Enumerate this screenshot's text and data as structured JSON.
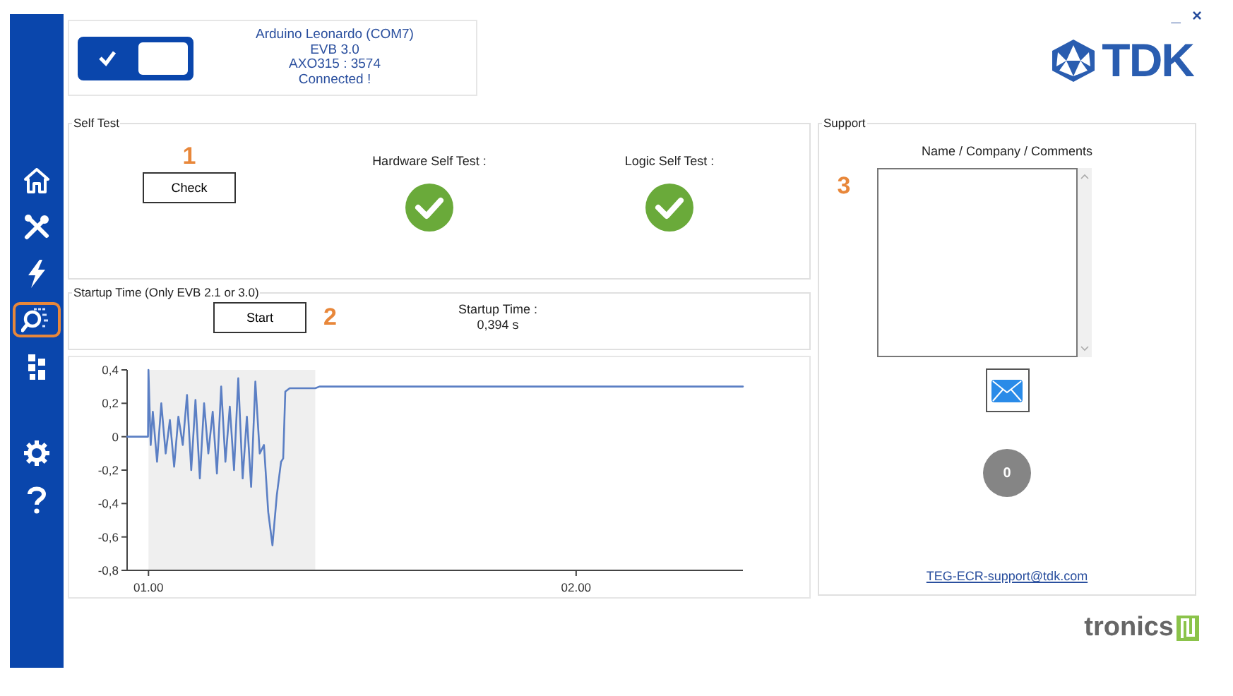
{
  "window_controls": [
    "_",
    "×"
  ],
  "sidebar": {
    "items": [
      {
        "selected": false
      },
      {
        "selected": false
      },
      {
        "selected": false
      },
      {
        "selected": true
      },
      {
        "selected": false
      }
    ],
    "bottom_items": [
      {
        "selected": false
      },
      {
        "selected": false
      }
    ]
  },
  "connection": {
    "on": true,
    "lines": [
      "Arduino Leonardo (COM7)",
      "EVB 3.0",
      "AXO315 : 3574",
      "Connected !"
    ]
  },
  "logo": "TDK",
  "self_test": {
    "title": "Self Test",
    "marker": "1",
    "button": "Check",
    "results": [
      {
        "label": "Hardware Self Test :",
        "passed": true
      },
      {
        "label": "Logic Self Test :",
        "passed": true
      }
    ]
  },
  "startup": {
    "title": "Startup Time (Only EVB 2.1 or 3.0)",
    "button": "Start",
    "marker": "2",
    "result_label": "Startup Time :",
    "result_value": "0,394 s"
  },
  "chart": {
    "chart_data": {
      "type": "line",
      "x": [
        0.95,
        0.999,
        1.0,
        1.005,
        1.01,
        1.02,
        1.03,
        1.04,
        1.05,
        1.06,
        1.07,
        1.08,
        1.09,
        1.1,
        1.11,
        1.12,
        1.13,
        1.14,
        1.15,
        1.16,
        1.17,
        1.18,
        1.19,
        1.2,
        1.21,
        1.22,
        1.23,
        1.24,
        1.25,
        1.26,
        1.27,
        1.28,
        1.29,
        1.3,
        1.31,
        1.315,
        1.32,
        1.33,
        1.39,
        1.4,
        2.39
      ],
      "series": [
        {
          "color": "#5b7fc4",
          "values": [
            0,
            0,
            0.4,
            -0.05,
            0.15,
            -0.15,
            0.2,
            -0.1,
            0.1,
            -0.18,
            0.12,
            -0.05,
            0.25,
            -0.2,
            0.22,
            -0.25,
            0.2,
            -0.1,
            0.15,
            -0.22,
            0.3,
            -0.15,
            0.18,
            -0.2,
            0.35,
            -0.25,
            0.12,
            -0.3,
            0.33,
            -0.1,
            -0.05,
            -0.45,
            -0.65,
            -0.35,
            -0.15,
            -0.13,
            0.27,
            0.29,
            0.29,
            0.3,
            0.3
          ]
        }
      ],
      "xlim": [
        0.95,
        2.39
      ],
      "ylim": [
        -0.8,
        0.4
      ],
      "xticks": [
        {
          "value": 1,
          "label": "01.00"
        },
        {
          "value": 2,
          "label": "02.00"
        }
      ],
      "yticks": [
        {
          "value": 0.4,
          "label": "0,4"
        },
        {
          "value": 0.2,
          "label": "0,2"
        },
        {
          "value": 0,
          "label": "0"
        },
        {
          "value": -0.2,
          "label": "-0,2"
        },
        {
          "value": -0.4,
          "label": "-0,4"
        },
        {
          "value": -0.6,
          "label": "-0,6"
        },
        {
          "value": -0.8,
          "label": "-0,8"
        }
      ],
      "bands": [
        {
          "axis": "x",
          "from": 1.0,
          "to": 1.39
        }
      ]
    }
  },
  "support": {
    "title": "Support",
    "field_label": "Name / Company / Comments",
    "marker": "3",
    "counter": "0",
    "email": "TEG-ECR-support@tdk.com"
  },
  "footer_logo": "tronics"
}
